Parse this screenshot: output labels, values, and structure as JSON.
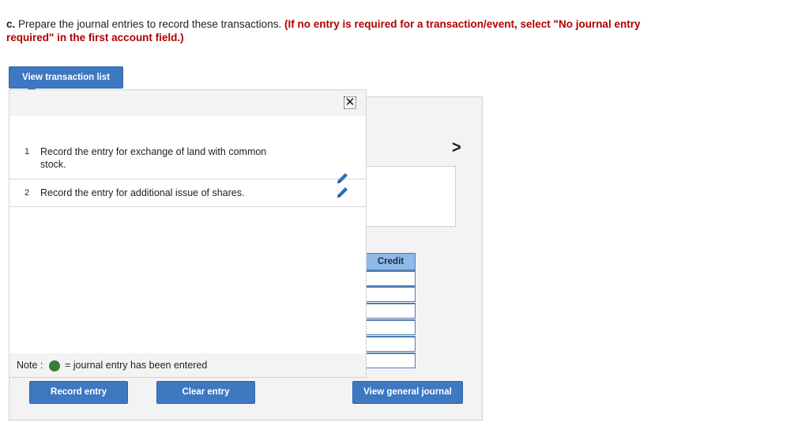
{
  "instruction": {
    "lead": "c.",
    "text": " Prepare the journal entries to record these transactions. ",
    "emphasis": "(If no entry is required for a transaction/event, select \"No journal entry required\" in the first account field.)"
  },
  "buttons": {
    "view_transaction_list": "View transaction list",
    "record_entry": "Record entry",
    "clear_entry": "Clear entry",
    "view_general_journal": "View general journal"
  },
  "transactions": [
    {
      "number": "1",
      "text": "Record the entry for exchange of land with common stock."
    },
    {
      "number": "2",
      "text": "Record the entry for additional issue of shares."
    }
  ],
  "popup": {
    "close_glyph": "✕"
  },
  "note": {
    "label": "Note :",
    "text": "= journal entry has been entered"
  },
  "journal": {
    "credit_header": "Credit",
    "forward_glyph": ">"
  },
  "colors": {
    "button": "#3d78c0",
    "emphasis": "#b00000",
    "entered_dot": "#3a7d37",
    "credit_header": "#8fb9e8"
  },
  "icons": {
    "close": "close-icon",
    "edit": "pencil-icon",
    "next": "chevron-right-icon"
  }
}
